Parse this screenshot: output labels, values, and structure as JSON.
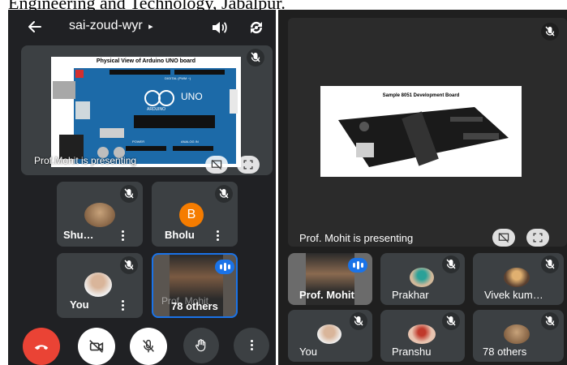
{
  "top_caption": "Engineering and Technology, Jabalpur.",
  "left": {
    "header": {
      "meeting_code": "sai-zoud-wyr",
      "chevron": "▸"
    },
    "presentation": {
      "slide_title": "Physical View of Arduino UNO board",
      "board_labels": {
        "digital": "DIGITAL (PWM ~)",
        "brand": "ARDUINO",
        "model": "UNO",
        "power": "POWER",
        "analog": "ANALOG IN"
      },
      "presenting_label": "Prof.Mohit is presenting"
    },
    "tiles": [
      {
        "name": "Shu…"
      },
      {
        "name": "Bholu",
        "initial": "B",
        "avatar_color": "#f57c00"
      },
      {
        "name": "You"
      },
      {
        "name": "78 others",
        "overlay_name": "Prof. Mohit"
      }
    ]
  },
  "right": {
    "presentation": {
      "slide_title": "Sample 8051 Development Board",
      "presenting_label": "Prof. Mohit is presenting"
    },
    "tiles": [
      {
        "name": "Prof. Mohit"
      },
      {
        "name": "Prakhar"
      },
      {
        "name": "Vivek kum…"
      },
      {
        "name": "You"
      },
      {
        "name": "Pranshu"
      },
      {
        "name": "78 others"
      }
    ]
  },
  "colors": {
    "end_call": "#ea4335",
    "speaking": "#1a73e8",
    "tile": "#3c4043",
    "background": "#202124"
  },
  "icons": [
    "back-arrow-icon",
    "speaker-icon",
    "switch-camera-icon",
    "mic-off-icon",
    "present-stop-icon",
    "fullscreen-icon",
    "end-call-icon",
    "camera-off-icon",
    "raise-hand-icon",
    "more-icon"
  ]
}
